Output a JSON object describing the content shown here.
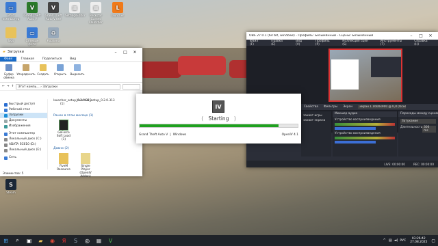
{
  "desktop": {
    "icons": [
      {
        "label": "Этот компьютер",
        "icon": "computer-icon",
        "color": "#3a7bd5",
        "glyph": "▭"
      },
      {
        "label": "Grand Theft Auto V",
        "icon": "gta-icon",
        "color": "#2b7a2b",
        "glyph": "V"
      },
      {
        "label": "Grand Theft Auto V.exe",
        "icon": "gta-exe-icon",
        "color": "#444",
        "glyph": "V"
      },
      {
        "label": "SettingsEditor",
        "icon": "settings-editor-icon",
        "color": "#eee",
        "glyph": "▦"
      },
      {
        "label": "Rockstar Games Launcher",
        "icon": "rockstar-icon",
        "color": "#eee",
        "glyph": "▦"
      },
      {
        "label": "launcher",
        "icon": "launcher-icon",
        "color": "#f07a1a",
        "glyph": "L"
      },
      {
        "label": "logs",
        "icon": "logs-folder-icon",
        "color": "#e8c25a",
        "glyph": ""
      },
      {
        "label": "Сетевые фото",
        "icon": "network-photos-icon",
        "color": "#3a7bd5",
        "glyph": "▭"
      },
      {
        "label": "Steam",
        "icon": "steam-icon",
        "color": "#1b2838",
        "glyph": "S"
      },
      {
        "label": "Корзина",
        "icon": "recycle-bin-icon",
        "color": "#9ab",
        "glyph": "♻"
      }
    ]
  },
  "explorer": {
    "title": "Загрузки",
    "tabs": [
      "Файл",
      "Главная",
      "Поделиться",
      "Вид"
    ],
    "ribbon": [
      "Буфер обмена",
      "Упорядочить",
      "Создать",
      "Открыть",
      "Выделить"
    ],
    "address": "Этот компь... › Загрузки",
    "nav": [
      "Быстрый доступ",
      "Рабочий стол",
      "Загрузки",
      "Документы",
      "Изображения",
      "Этот компьютер",
      "Локальный диск (C:)",
      "ADATA SC610 (D:)",
      "Локальный диск (E:)",
      "Сеть"
    ],
    "top_files": [
      "launcher_setup_0.2.0.313 (1)",
      "launcher_setup_0.2.0.313"
    ],
    "group1": "Ранее в этом месяце (1)",
    "group1_files": [
      "GeForce Soft Load (1)"
    ],
    "group2": "Давно (2)",
    "group2_files": [
      "FiveM Resource",
      "Single Player (OpenIV Addon)"
    ],
    "status": "Элементов: 5"
  },
  "obs": {
    "title": "OBS 27.0.1 (64 bit, windows) - Профиль: Безымянный - Сцены: Безымянный",
    "menu": [
      "Файл (F)",
      "Правка (E)",
      "Вид (V)",
      "Профиль (P)",
      "Коллекция сцен (S)",
      "Инструменты (T)",
      "Справка (H)"
    ],
    "toolbar": [
      "Свойства",
      "Фильтры",
      "Экран",
      "Экран 1 1600x900 @ 0,0 (Основной монитор)"
    ],
    "mixer_title": "Микшер аудио",
    "mixer": [
      "Устройство воспроизведения",
      "Устройство воспроизведения"
    ],
    "transitions_title": "Переходы между сценами",
    "transition": "Затухание",
    "duration_label": "Длительность",
    "duration": "300 ms",
    "live": "LIVE: 00:00:00",
    "rec": "REC: 00:00:00",
    "sources": [
      "захват игры",
      "захват экрана"
    ]
  },
  "dialog": {
    "logo": "IV",
    "status": "Starting",
    "progress": 0.88,
    "game": "Grand Theft Auto V",
    "platform": "Windows",
    "version": "OpenIV 4.1"
  },
  "taskbar": {
    "time": "03:26:42",
    "date": "27.08.2025",
    "lang": "РУС"
  }
}
